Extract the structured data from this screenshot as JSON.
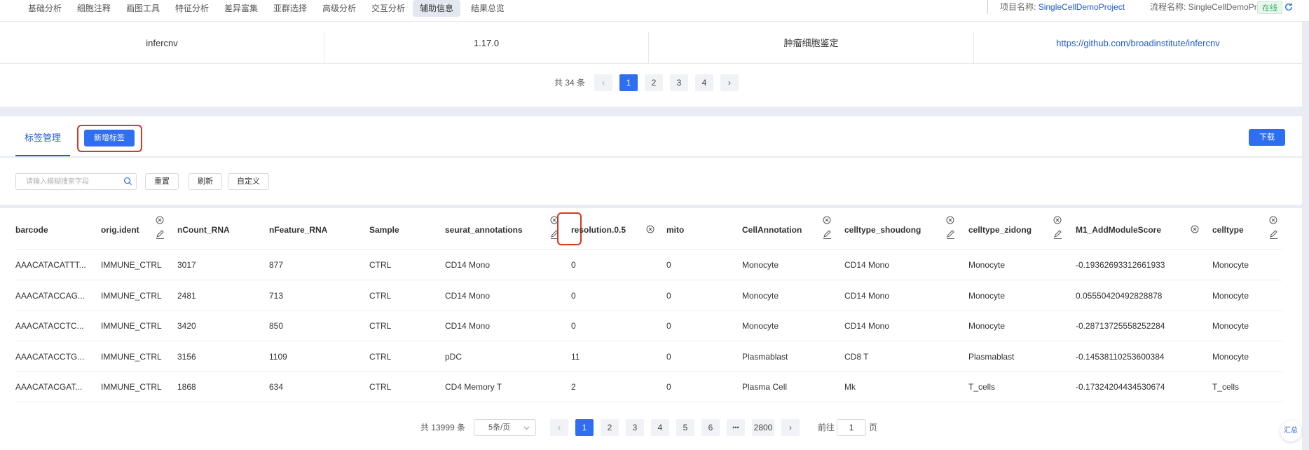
{
  "nav": {
    "tabs": [
      "基础分析",
      "细胞注释",
      "画图工具",
      "特征分析",
      "差异富集",
      "亚群选择",
      "高级分析",
      "交互分析",
      "辅助信息",
      "结果总览"
    ],
    "active_index": 8
  },
  "project": {
    "project_label": "项目名称:",
    "project_value": "SingleCellDemoProject",
    "process_label": "流程名称:",
    "process_value": "SingleCellDemoProcess",
    "status": "在线"
  },
  "software_table": {
    "row": [
      "infercnv",
      "1.17.0",
      "肿瘤细胞鉴定",
      "https://github.com/broadinstitute/infercnv"
    ],
    "pager": {
      "total_text": "共 34 条",
      "pages": [
        "1",
        "2",
        "3",
        "4"
      ],
      "current": "1",
      "prev": "‹",
      "next": "›"
    }
  },
  "labels_panel": {
    "tab_label": "标签管理",
    "add_button": "新增标签",
    "download_button": "下载",
    "search_placeholder": "请输入模糊搜索字段",
    "reset_button": "重置",
    "refresh_button": "刷新",
    "custom_button": "自定义"
  },
  "data_table": {
    "columns": [
      "barcode",
      "orig.ident",
      "nCount_RNA",
      "nFeature_RNA",
      "Sample",
      "seurat_annotations",
      "resolution.0.5",
      "mito",
      "CellAnnotation",
      "celltype_shoudong",
      "celltype_zidong",
      "M1_AddModuleScore",
      "celltype"
    ],
    "rows": [
      [
        "AAACATACATTT...",
        "IMMUNE_CTRL",
        "3017",
        "877",
        "CTRL",
        "CD14 Mono",
        "0",
        "0",
        "Monocyte",
        "CD14 Mono",
        "Monocyte",
        "-0.19362693312661933",
        "Monocyte"
      ],
      [
        "AAACATACCAG...",
        "IMMUNE_CTRL",
        "2481",
        "713",
        "CTRL",
        "CD14 Mono",
        "0",
        "0",
        "Monocyte",
        "CD14 Mono",
        "Monocyte",
        "0.05550420492828878",
        "Monocyte"
      ],
      [
        "AAACATACCTC...",
        "IMMUNE_CTRL",
        "3420",
        "850",
        "CTRL",
        "CD14 Mono",
        "0",
        "0",
        "Monocyte",
        "CD14 Mono",
        "Monocyte",
        "-0.28713725558252284",
        "Monocyte"
      ],
      [
        "AAACATACCTG...",
        "IMMUNE_CTRL",
        "3156",
        "1109",
        "CTRL",
        "pDC",
        "11",
        "0",
        "Plasmablast",
        "CD8 T",
        "Plasmablast",
        "-0.14538110253600384",
        "Monocyte"
      ],
      [
        "AAACATACGAT...",
        "IMMUNE_CTRL",
        "1868",
        "634",
        "CTRL",
        "CD4 Memory T",
        "2",
        "0",
        "Plasma Cell",
        "Mk",
        "T_cells",
        "-0.17324204434530674",
        "T_cells"
      ]
    ],
    "pager": {
      "total_text": "共 13999 条",
      "page_size": "5条/页",
      "pages": [
        "1",
        "2",
        "3",
        "4",
        "5",
        "6",
        "•••",
        "2800"
      ],
      "current": "1",
      "prev": "‹",
      "next": "›",
      "goto_label": "前往",
      "goto_value": "1",
      "goto_suffix": "页"
    }
  },
  "float_button": "汇总",
  "colors": {
    "primary": "#2e6ef0",
    "link": "#1f5bd8",
    "highlight": "#d9381e",
    "online": "#3ba55c"
  }
}
